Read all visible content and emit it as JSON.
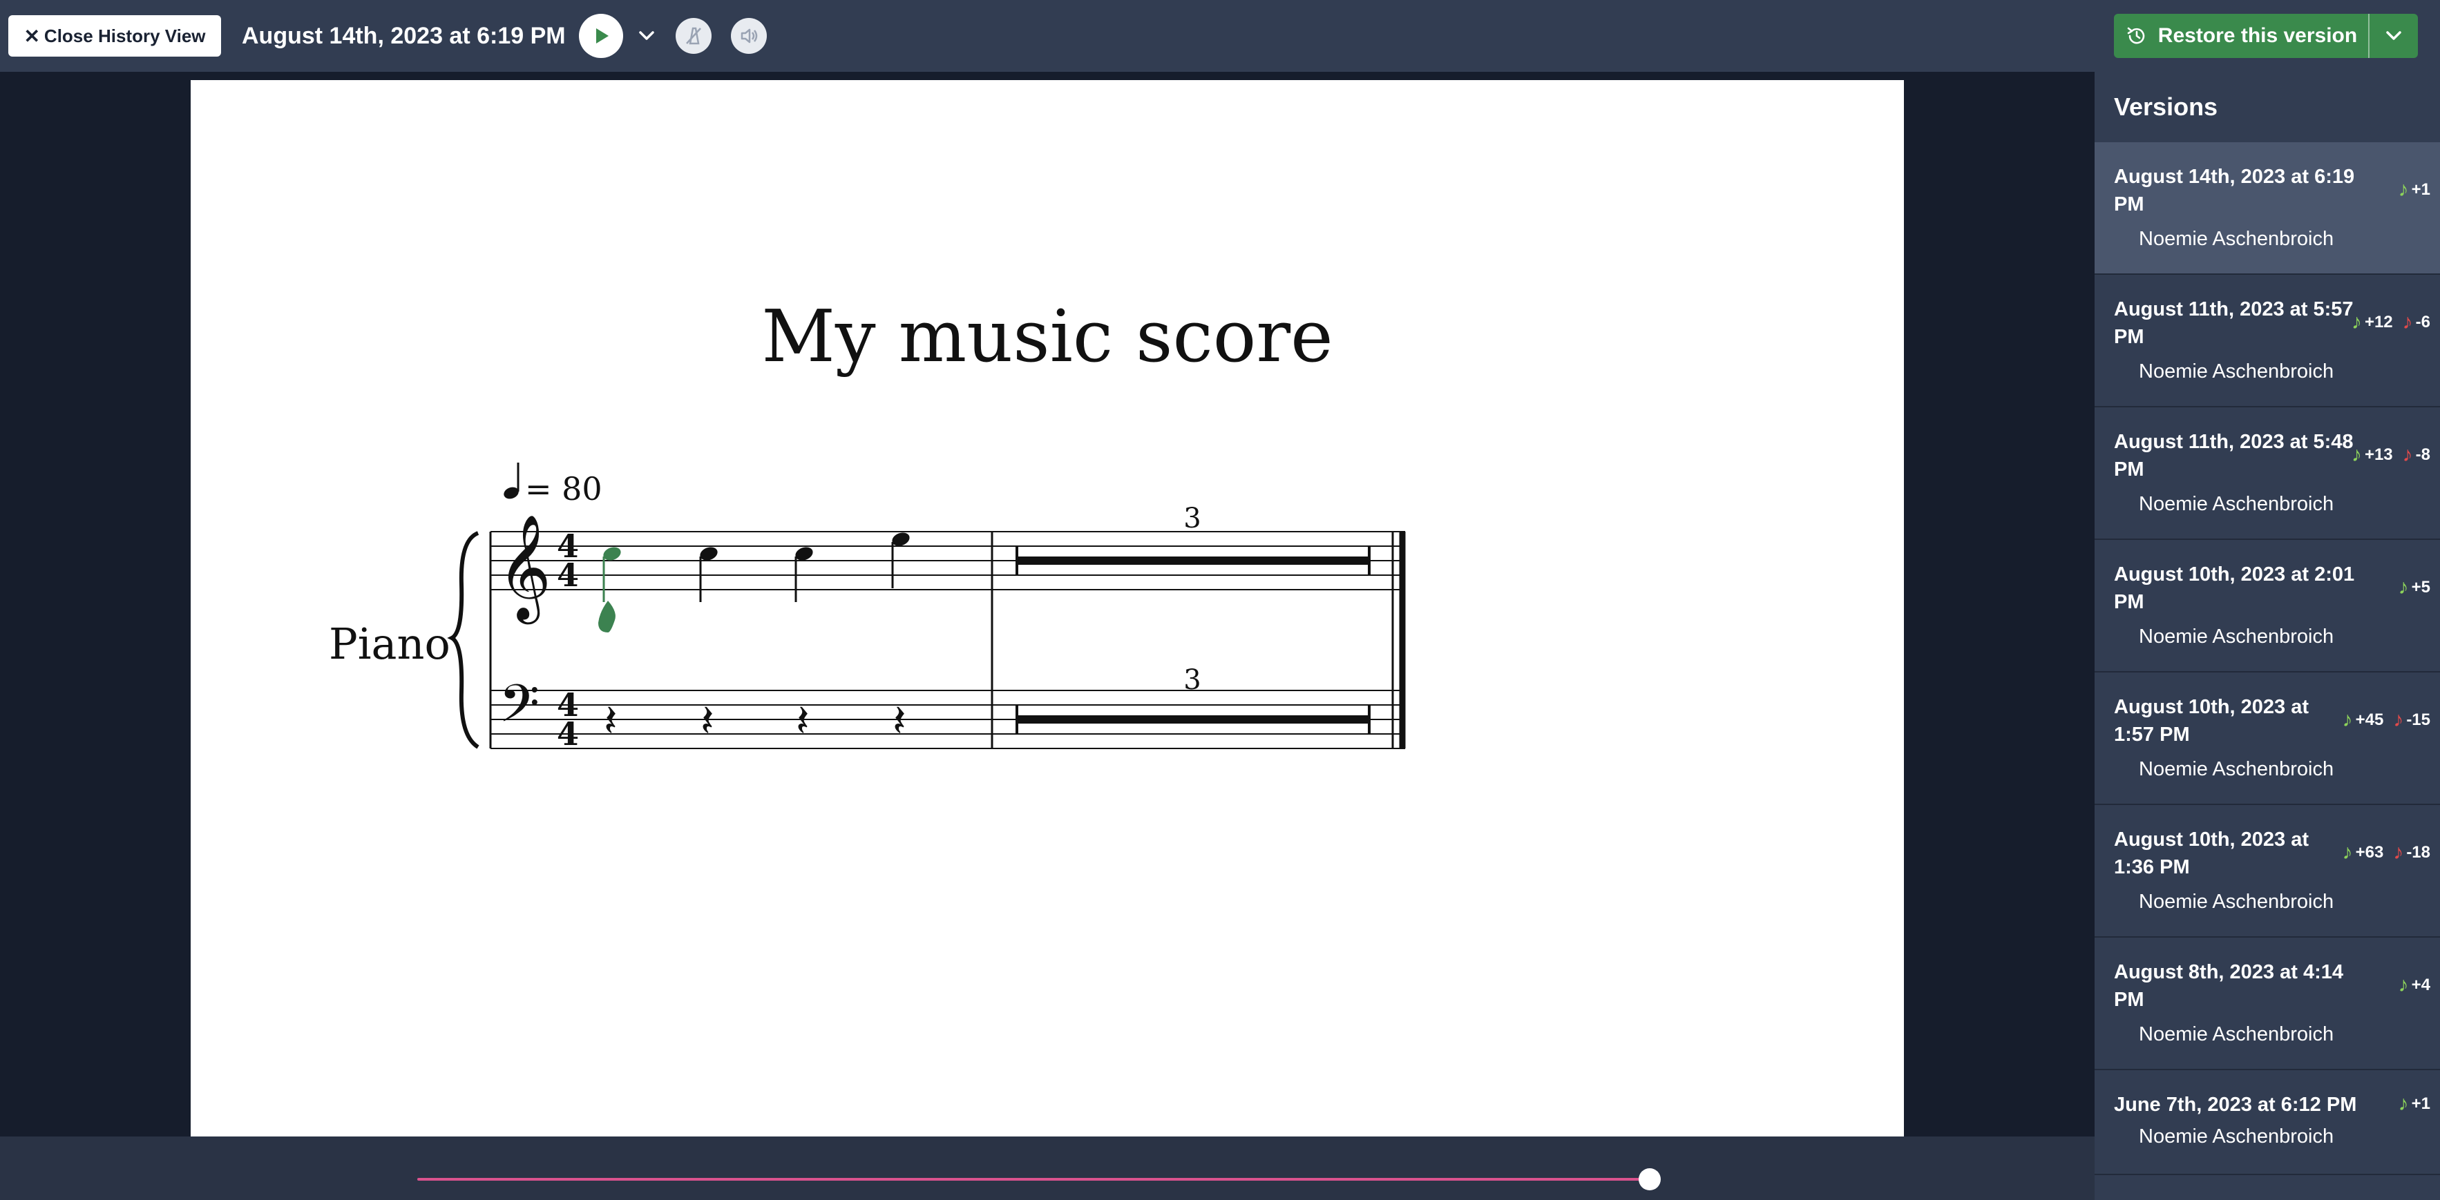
{
  "toolbar": {
    "close_label": "Close History View",
    "version_title": "August 14th, 2023 at 6:19 PM",
    "restore_label": "Restore this version"
  },
  "score": {
    "title": "My music score",
    "instrument": "Piano",
    "tempo": "= 80",
    "tuplet_top": "3",
    "tuplet_bottom": "3",
    "time_signature": "4/4"
  },
  "colors": {
    "accent_green": "#3a8a4c",
    "slider_pink": "#d9538e",
    "added_note": "#8dd35b",
    "removed_note": "#e24a4a",
    "highlighted_note": "#3c8250"
  },
  "timeline": {
    "position": 1.0
  },
  "sidebar": {
    "title": "Versions",
    "versions": [
      {
        "date": "August 14th, 2023 at 6:19 PM",
        "author": "Noemie Aschenbroich",
        "added": "+1",
        "removed": ""
      },
      {
        "date": "August 11th, 2023 at 5:57 PM",
        "author": "Noemie Aschenbroich",
        "added": "+12",
        "removed": "-6"
      },
      {
        "date": "August 11th, 2023 at 5:48 PM",
        "author": "Noemie Aschenbroich",
        "added": "+13",
        "removed": "-8"
      },
      {
        "date": "August 10th, 2023 at 2:01 PM",
        "author": "Noemie Aschenbroich",
        "added": "+5",
        "removed": ""
      },
      {
        "date": "August 10th, 2023 at 1:57 PM",
        "author": "Noemie Aschenbroich",
        "added": "+45",
        "removed": "-15"
      },
      {
        "date": "August 10th, 2023 at 1:36 PM",
        "author": "Noemie Aschenbroich",
        "added": "+63",
        "removed": "-18"
      },
      {
        "date": "August 8th, 2023 at 4:14 PM",
        "author": "Noemie Aschenbroich",
        "added": "+4",
        "removed": ""
      },
      {
        "date": "June 7th, 2023 at 6:12 PM",
        "author": "Noemie Aschenbroich",
        "added": "+1",
        "removed": ""
      }
    ]
  }
}
